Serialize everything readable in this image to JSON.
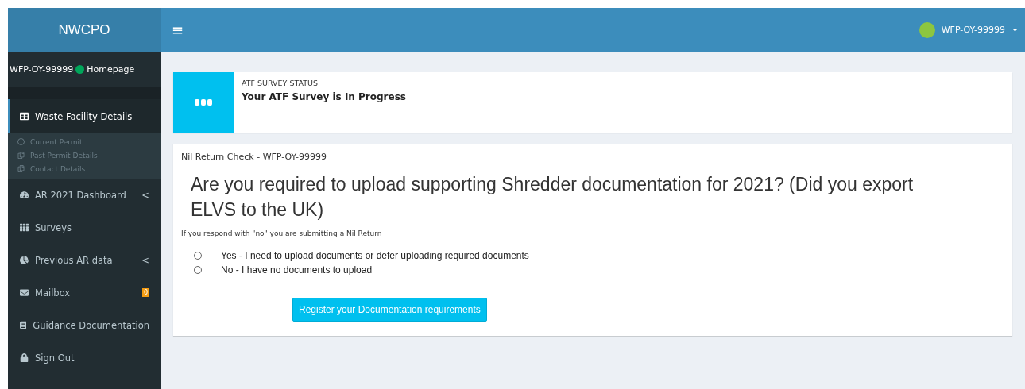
{
  "brand": "NWCPO",
  "user_panel": {
    "user": "WFP-OY-99999",
    "link": "Homepage"
  },
  "sidebar": {
    "items": [
      {
        "label": "Waste Facility Details",
        "selected": true,
        "expanded": true,
        "children": [
          {
            "label": "Current Permit"
          },
          {
            "label": "Past Permit Details"
          },
          {
            "label": "Contact Details"
          }
        ]
      },
      {
        "label": "AR 2021 Dashboard",
        "selected": false,
        "expanded": false,
        "caret": "<"
      },
      {
        "label": "Surveys",
        "selected": false
      },
      {
        "label": "Previous AR data",
        "selected": false,
        "expanded": false,
        "caret": "<"
      },
      {
        "label": "Mailbox",
        "selected": false,
        "badge": "0"
      },
      {
        "label": "Guidance Documentation",
        "selected": false
      },
      {
        "label": "Sign Out",
        "selected": false
      }
    ]
  },
  "header": {
    "menu": "≡",
    "user": "WFP-OY-99999"
  },
  "status_box": {
    "label": "ATF SURVEY STATUS",
    "value": "Your ATF Survey is In Progress"
  },
  "panel": {
    "title": "Nil Return Check - WFP-OY-99999",
    "question": "Are you required to upload supporting Shredder documentation for 2021? (Did you export ELVS to the UK)",
    "hint": "If you respond with \"no\" you are submitting a Nil Return",
    "options": [
      {
        "label": "Yes - I need to upload documents or defer uploading required documents",
        "selected": false
      },
      {
        "label": "No - I have no documents to upload",
        "selected": false
      }
    ],
    "button": "Register your Documentation requirements"
  }
}
